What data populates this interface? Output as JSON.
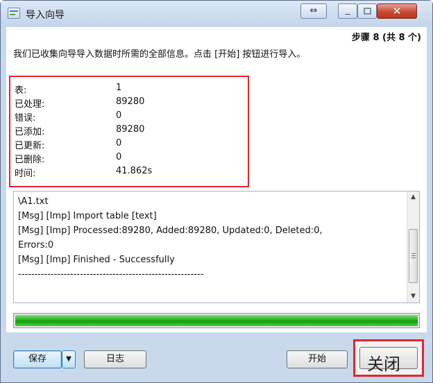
{
  "window": {
    "title": "导入向导",
    "restore_glyph": "⇔",
    "close_glyph": "✕"
  },
  "wizard": {
    "step": "步骤 8 (共 8 个)",
    "info": "我们已收集向导导入数据时所需的全部信息。点击 [开始] 按钮进行导入。"
  },
  "summary": [
    {
      "label": "表:",
      "value": "1"
    },
    {
      "label": "已处理:",
      "value": "89280"
    },
    {
      "label": "错误:",
      "value": "0"
    },
    {
      "label": "已添加:",
      "value": "89280"
    },
    {
      "label": "已更新:",
      "value": "0"
    },
    {
      "label": "已删除:",
      "value": "0"
    },
    {
      "label": "时间:",
      "value": "41.862s"
    }
  ],
  "log": {
    "lines": [
      "\\A1.txt",
      "[Msg] [Imp] Import table [text]",
      "[Msg] [Imp] Processed:89280, Added:89280, Updated:0, Deleted:0,",
      "Errors:0",
      "[Msg] [Imp] Finished - Successfully",
      "---------------------------------------------------------"
    ]
  },
  "progress": {
    "percent": 100,
    "color": "#22b61c"
  },
  "footer": {
    "save": "保存",
    "save_arrow": "▼",
    "log": "日志",
    "start": "开始",
    "close": "关闭"
  },
  "icons": {
    "app": "table-import-icon",
    "scroll_up": "▲",
    "scroll_down": "▼"
  }
}
